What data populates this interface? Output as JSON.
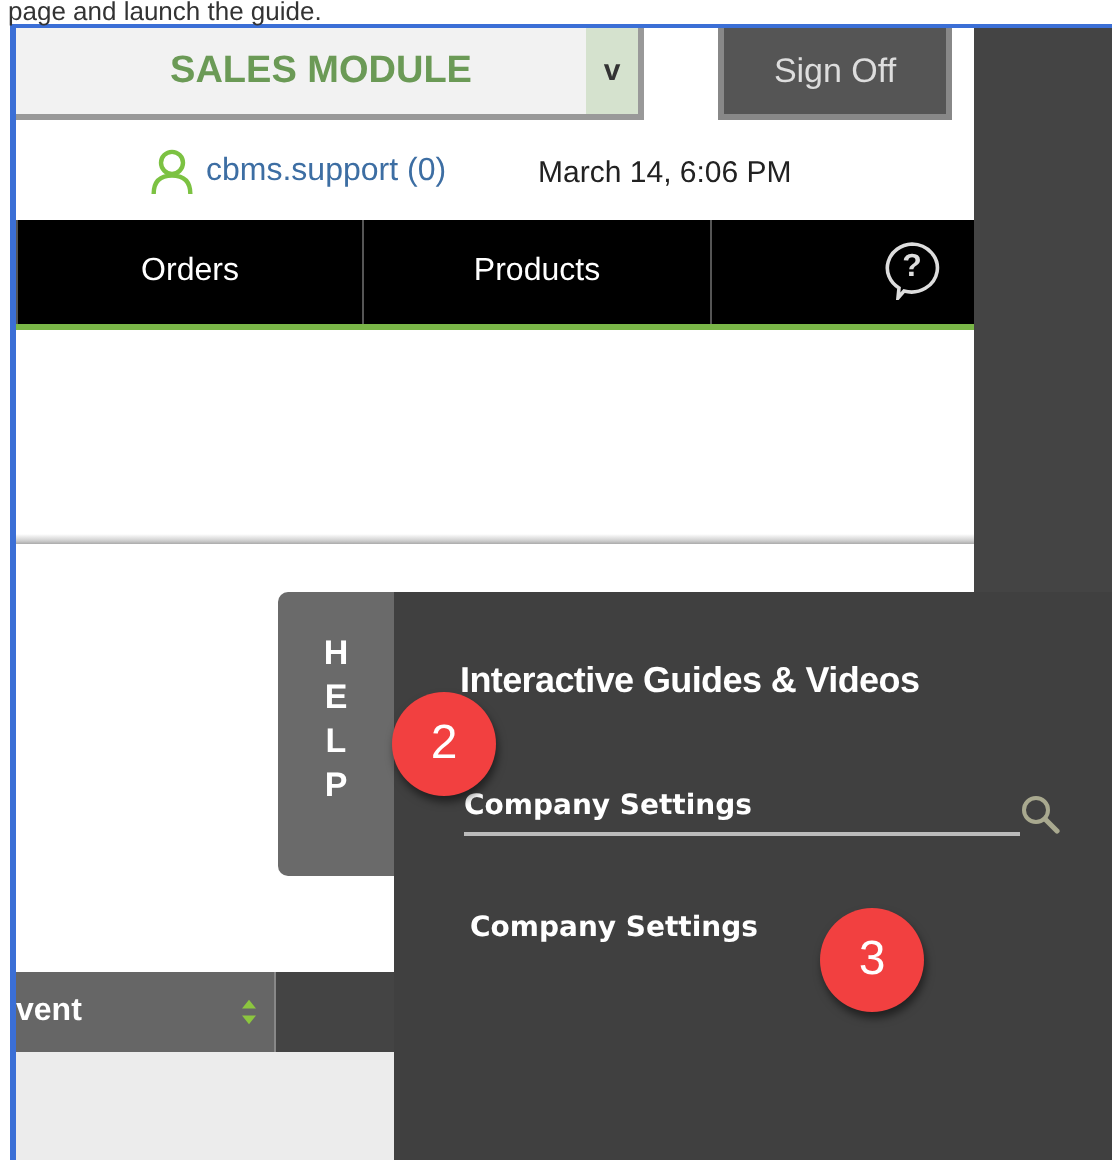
{
  "caption": "page and launch the guide.",
  "module_select": {
    "value": "SALES MODULE",
    "caret": "v"
  },
  "sign_off": "Sign Off",
  "user": {
    "name": "cbms.support",
    "count": "(0)"
  },
  "datetime": "March 14, 6:06 PM",
  "nav": [
    {
      "label": "Orders"
    },
    {
      "label": "Products"
    }
  ],
  "nav_help": "?",
  "table": {
    "columns": [
      {
        "label": "vent",
        "sortable": true
      }
    ]
  },
  "help_tab": "HELP",
  "help_panel": {
    "title": "Interactive Guides & Videos",
    "search": {
      "value": "Company Settings"
    },
    "results": [
      "Company Settings"
    ]
  },
  "callouts": [
    {
      "number": "2"
    },
    {
      "number": "3"
    }
  ]
}
